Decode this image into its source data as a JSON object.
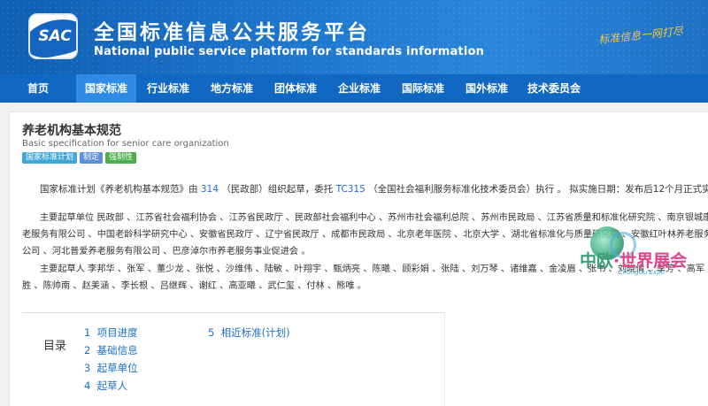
{
  "header": {
    "logo_text": "SAC",
    "title": "全国标准信息公共服务平台",
    "subtitle": "National public service platform  for standards information",
    "slogan": "标准信息一网打尽"
  },
  "nav": {
    "items": [
      {
        "label": "首页",
        "active": false
      },
      {
        "label": "国家标准",
        "active": true
      },
      {
        "label": "行业标准",
        "active": false
      },
      {
        "label": "地方标准",
        "active": false
      },
      {
        "label": "团体标准",
        "active": false
      },
      {
        "label": "企业标准",
        "active": false
      },
      {
        "label": "国际标准",
        "active": false
      },
      {
        "label": "国外标准",
        "active": false
      },
      {
        "label": "技术委员会",
        "active": false
      }
    ]
  },
  "standard": {
    "title": "养老机构基本规范",
    "title_en": "Basic specification for senior care organization",
    "tags": [
      {
        "label": "国家标准计划",
        "color": "#3ea7d8"
      },
      {
        "label": "制定",
        "color": "#5b8fd6"
      },
      {
        "label": "强制性",
        "color": "#4cae4c"
      }
    ]
  },
  "description": {
    "p1_prefix": "国家标准计划《养老机构基本规范》由",
    "p1_link1": "314",
    "p1_mid": "（民政部）组织起草，委托",
    "p1_link2": "TC315",
    "p1_suffix": "（全国社会福利服务标准化技术委员会）执行 。 拟实施日期：发布后12个月正式实施。",
    "p2_line1": "主要起草单位 民政部 、江苏省社会福利协会 、江苏省民政厅 、民政部社会福利中心 、苏州市社会福利总院 、苏州市民政局 、江苏省质量和标准化研究院 、南京银城康养养",
    "p2_line2": "老服务有限公司 、中国老龄科学研究中心 、安徽省民政厅 、辽宁省民政厅 、成都市民政局 、北京老年医院 、北京大学 、湖北省标准化与质量研究院 、安徽红叶林养老服务有限",
    "p2_line3": "公司 、河北普爱养老服务有限公司 、巴彦淖尔市养老服务事业促进会 。",
    "p3_line1": "主要起草人 李邦华 、张军 、董少龙 、张悦 、沙维伟 、陆敏 、叶翔宇 、甄炳亮 、陈曦 、顾彩娟 、张陆 、刘万琴 、诸维嘉 、金凌眉 、张书 、刘晓倩 、季芳 、高军 、苗文",
    "p3_line2": "胜 、陈帅南 、赵美涵 、李长根 、吕继辉 、谢红 、高亚曦 、武仁玺 、付林 、熊唯 。"
  },
  "toc": {
    "label": "目录",
    "items": [
      {
        "num": "1",
        "label": "项目进度"
      },
      {
        "num": "2",
        "label": "基础信息"
      },
      {
        "num": "3",
        "label": "起草单位"
      },
      {
        "num": "4",
        "label": "起草人"
      },
      {
        "num": "5",
        "label": "相近标准(计划)"
      }
    ]
  },
  "expo": {
    "name_a": "中欧",
    "name_b": "·世界展会",
    "en": "ZhongOu Expo"
  }
}
